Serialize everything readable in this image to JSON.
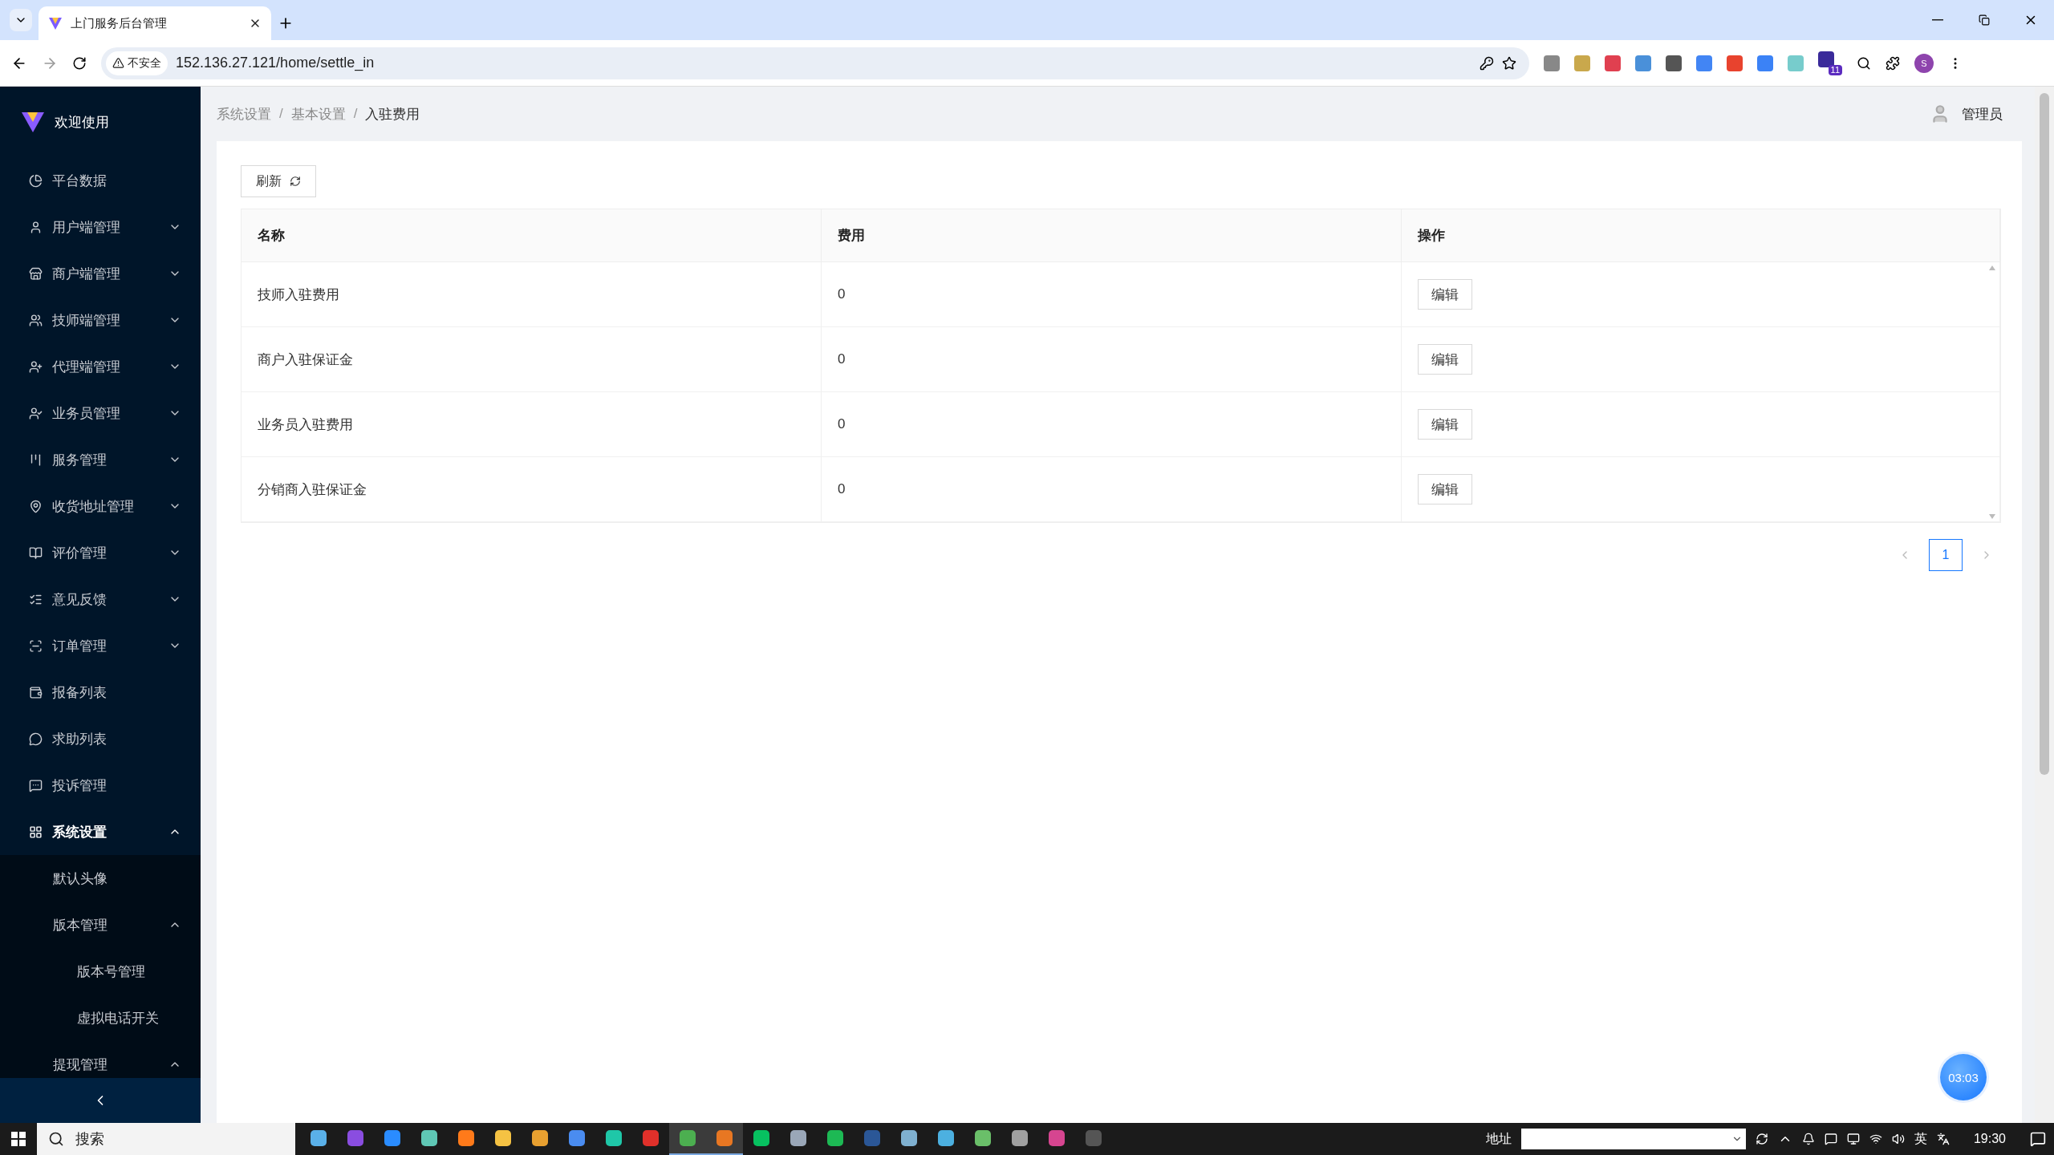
{
  "browser": {
    "tab_title": "上门服务后台管理",
    "security": "不安全",
    "url": "152.136.27.121/home/settle_in",
    "badge": "11",
    "profile": "S"
  },
  "sidebar": {
    "brand": "欢迎使用",
    "items": [
      {
        "label": "平台数据",
        "selected": false
      },
      {
        "label": "用户端管理",
        "selected": false,
        "expanded": false
      },
      {
        "label": "商户端管理",
        "selected": false,
        "expanded": false
      },
      {
        "label": "技师端管理",
        "selected": false,
        "expanded": false
      },
      {
        "label": "代理端管理",
        "selected": false,
        "expanded": false
      },
      {
        "label": "业务员管理",
        "selected": false,
        "expanded": false
      },
      {
        "label": "服务管理",
        "selected": false,
        "expanded": false
      },
      {
        "label": "收货地址管理",
        "selected": false,
        "expanded": false
      },
      {
        "label": "评价管理",
        "selected": false,
        "expanded": false
      },
      {
        "label": "意见反馈",
        "selected": false,
        "expanded": false
      },
      {
        "label": "订单管理",
        "selected": false,
        "expanded": false
      },
      {
        "label": "报备列表",
        "selected": false
      },
      {
        "label": "求助列表",
        "selected": false
      },
      {
        "label": "投诉管理",
        "selected": false
      },
      {
        "label": "系统设置",
        "selected": true,
        "expanded": true,
        "children": [
          {
            "label": "默认头像"
          },
          {
            "label": "版本管理",
            "expanded": true,
            "children": [
              {
                "label": "版本号管理"
              },
              {
                "label": "虚拟电话开关"
              }
            ]
          },
          {
            "label": "提现管理",
            "expanded": true
          }
        ]
      }
    ]
  },
  "breadcrumb": [
    "系统设置",
    "基本设置",
    "入驻费用"
  ],
  "breadcrumb_separator": "/",
  "user": "管理员",
  "refresh_button": "刷新",
  "table": {
    "columns": [
      "名称",
      "费用",
      "操作"
    ],
    "rows": [
      {
        "name": "技师入驻费用",
        "fee": "0",
        "action": "编辑"
      },
      {
        "name": "商户入驻保证金",
        "fee": "0",
        "action": "编辑"
      },
      {
        "name": "业务员入驻费用",
        "fee": "0",
        "action": "编辑"
      },
      {
        "name": "分销商入驻保证金",
        "fee": "0",
        "action": "编辑"
      }
    ]
  },
  "pagination": {
    "pages": [
      {
        "label": "1",
        "selected": true
      }
    ]
  },
  "timer": "03:03",
  "taskbar": {
    "search": "搜索",
    "apps": [
      {
        "active": false
      },
      {
        "active": false
      },
      {
        "active": false
      },
      {
        "active": false
      },
      {
        "active": false
      },
      {
        "active": false
      },
      {
        "active": false
      },
      {
        "active": false
      },
      {
        "active": false
      },
      {
        "active": false
      },
      {
        "active": true
      },
      {
        "active": true
      },
      {
        "active": false
      },
      {
        "active": false
      },
      {
        "active": false
      },
      {
        "active": false
      },
      {
        "active": false
      },
      {
        "active": false
      },
      {
        "active": false
      },
      {
        "active": false
      },
      {
        "active": false
      },
      {
        "active": false
      }
    ],
    "address_label": "地址",
    "ime": "英",
    "time": "19:30"
  }
}
